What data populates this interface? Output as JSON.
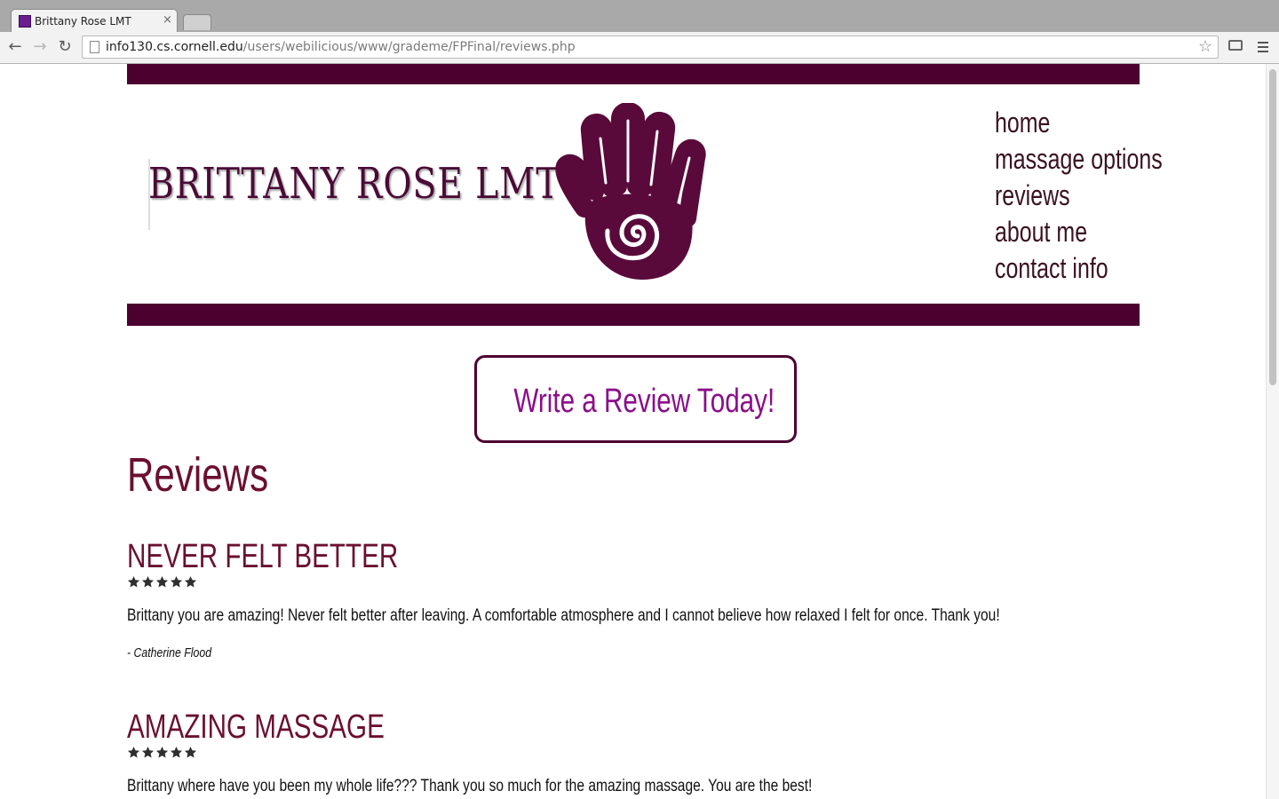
{
  "browser": {
    "tab_title": "Brittany Rose LMT",
    "tab_close": "×",
    "url_host": "info130.cs.cornell.edu",
    "url_path": "/users/webilicious/www/grademe/FPFinal/reviews.php",
    "back": "←",
    "forward": "→",
    "reload": "↻",
    "star": "☆"
  },
  "site": {
    "brand": "BRITTANY ROSE LMT",
    "accent_color": "#4c0030",
    "heading_color": "#6b0f30",
    "cta_color": "#8a0e8a",
    "nav": [
      {
        "label": "home"
      },
      {
        "label": "massage options"
      },
      {
        "label": "reviews"
      },
      {
        "label": "about me"
      },
      {
        "label": "contact info"
      }
    ],
    "cta_label": "Write a Review Today!",
    "page_title": "Reviews"
  },
  "reviews": [
    {
      "title": "NEVER FELT BETTER",
      "rating": 5,
      "body": "Brittany you are amazing! Never felt better after leaving. A comfortable atmosphere and I cannot believe how relaxed I felt for once. Thank you!",
      "author": "- Catherine Flood"
    },
    {
      "title": "AMAZING MASSAGE",
      "rating": 5,
      "body": "Brittany where have you been my whole life??? Thank you so much for the amazing massage. You are the best!",
      "author": ""
    }
  ]
}
